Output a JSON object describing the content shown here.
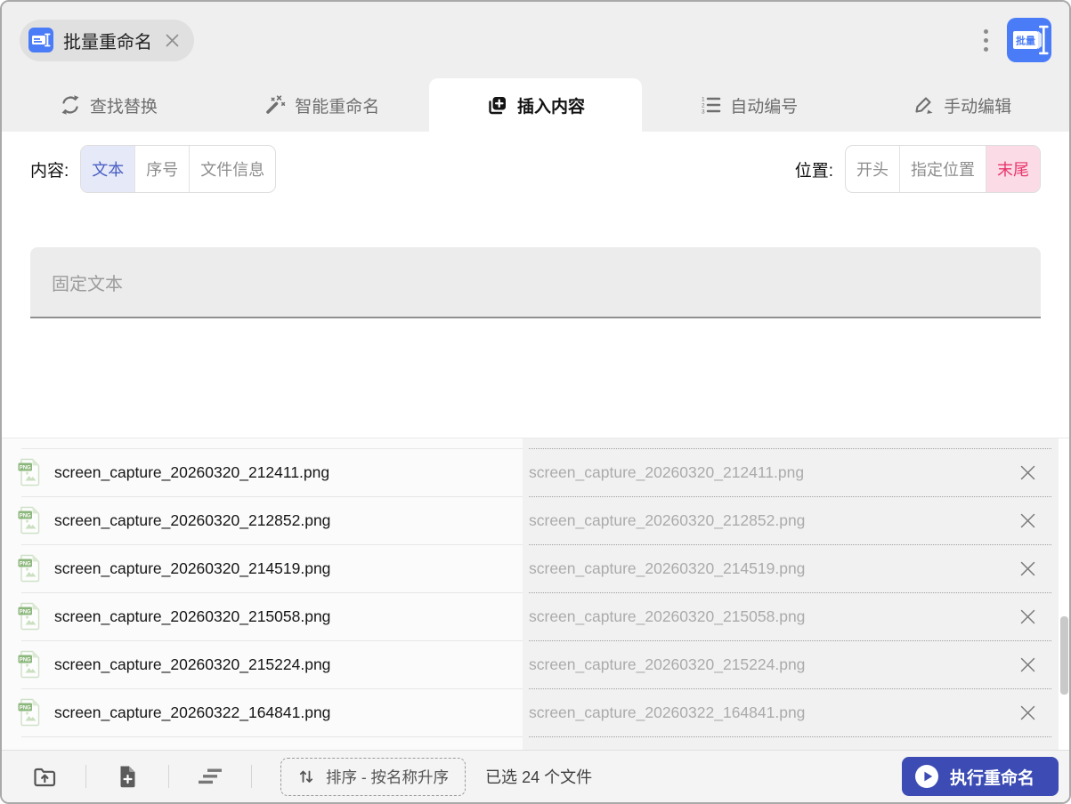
{
  "header": {
    "doc_tab_label": "批量重命名",
    "app_icon_label": "批量"
  },
  "tabs": [
    {
      "label": "查找替换",
      "icon": "swap-arrows",
      "active": false
    },
    {
      "label": "智能重命名",
      "icon": "magic-wand",
      "active": false
    },
    {
      "label": "插入内容",
      "icon": "insert-square-plus",
      "active": true
    },
    {
      "label": "自动编号",
      "icon": "numbered-list",
      "active": false
    },
    {
      "label": "手动编辑",
      "icon": "pencil-edit",
      "active": false
    }
  ],
  "panel": {
    "content_label": "内容:",
    "content_options": [
      {
        "label": "文本",
        "selected": true
      },
      {
        "label": "序号",
        "selected": false
      },
      {
        "label": "文件信息",
        "selected": false
      }
    ],
    "position_label": "位置:",
    "position_options": [
      {
        "label": "开头",
        "selected": false
      },
      {
        "label": "指定位置",
        "selected": false
      },
      {
        "label": "末尾",
        "selected": true
      }
    ],
    "input_value": "",
    "input_placeholder": "固定文本"
  },
  "files": [
    {
      "name": "screen_capture_20260320_212411.png",
      "preview": "screen_capture_20260320_212411.png"
    },
    {
      "name": "screen_capture_20260320_212852.png",
      "preview": "screen_capture_20260320_212852.png"
    },
    {
      "name": "screen_capture_20260320_214519.png",
      "preview": "screen_capture_20260320_214519.png"
    },
    {
      "name": "screen_capture_20260320_215058.png",
      "preview": "screen_capture_20260320_215058.png"
    },
    {
      "name": "screen_capture_20260320_215224.png",
      "preview": "screen_capture_20260320_215224.png"
    },
    {
      "name": "screen_capture_20260322_164841.png",
      "preview": "screen_capture_20260322_164841.png"
    }
  ],
  "footer": {
    "sort_label": "排序 - 按名称升序",
    "selected_count_text": "已选 24 个文件",
    "execute_label": "执行重命名"
  },
  "colors": {
    "accent_blue": "#4a7cf7",
    "content_selected_text": "#4a5fc4",
    "content_selected_bg": "#e6e9f7",
    "position_selected_text": "#e8376d",
    "position_selected_bg": "#fbdbe6",
    "execute_button_bg": "#3c4cb4",
    "header_bg": "#efefef"
  }
}
